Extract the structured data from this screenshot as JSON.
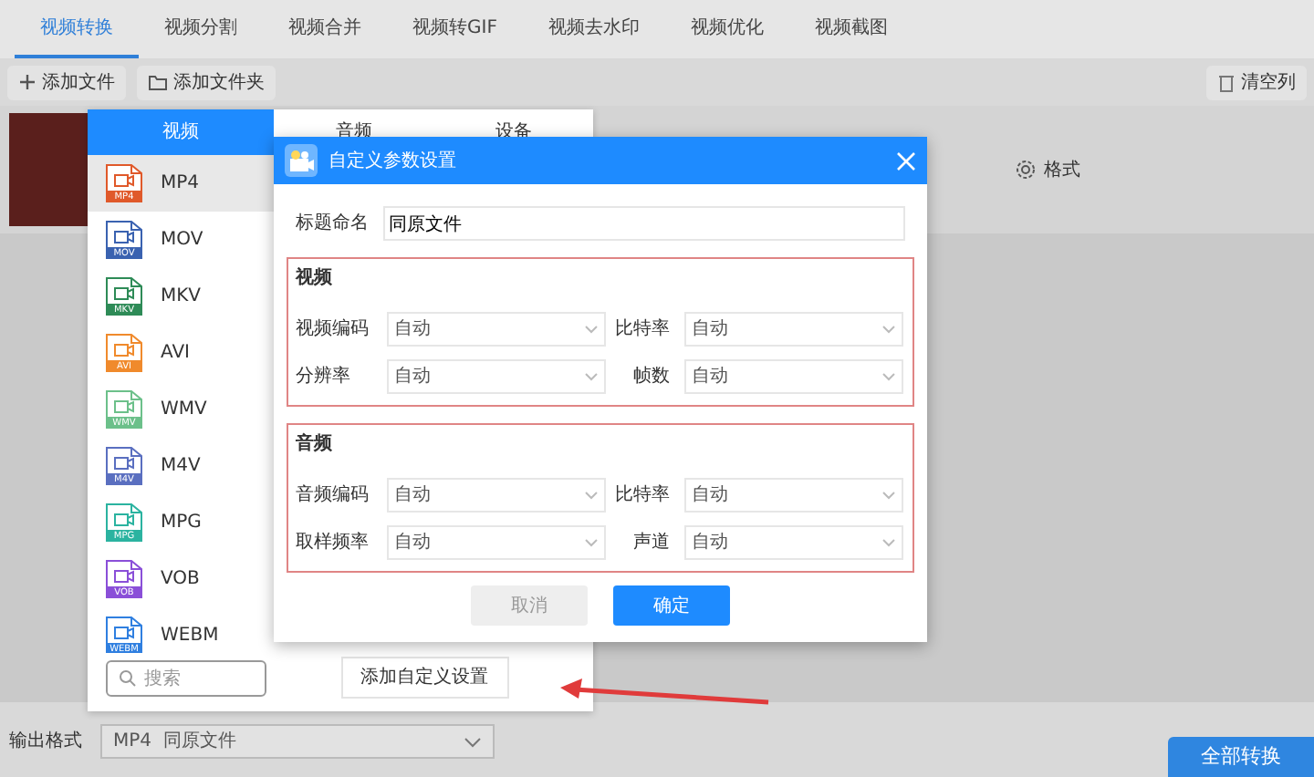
{
  "tabs": [
    {
      "label": "视频转换",
      "selected": true
    },
    {
      "label": "视频分割",
      "selected": false
    },
    {
      "label": "视频合并",
      "selected": false
    },
    {
      "label": "视频转GIF",
      "selected": false
    },
    {
      "label": "视频去水印",
      "selected": false
    },
    {
      "label": "视频优化",
      "selected": false
    },
    {
      "label": "视频截图",
      "selected": false
    }
  ],
  "toolbar": {
    "add_file": "添加文件",
    "add_folder": "添加文件夹",
    "clear_list": "清空列"
  },
  "file": {
    "format_button": "格式"
  },
  "format_panel": {
    "tabs": [
      {
        "label": "视频",
        "selected": true
      },
      {
        "label": "音频",
        "selected": false
      },
      {
        "label": "设备",
        "selected": false
      }
    ],
    "formats": [
      {
        "label": "MP4",
        "badge": "MP4",
        "color": "#e0592a",
        "selected": true
      },
      {
        "label": "MOV",
        "badge": "MOV",
        "color": "#3a62b0",
        "selected": false
      },
      {
        "label": "MKV",
        "badge": "MKV",
        "color": "#2e8b57",
        "selected": false
      },
      {
        "label": "AVI",
        "badge": "AVI",
        "color": "#f08a2c",
        "selected": false
      },
      {
        "label": "WMV",
        "badge": "WMV",
        "color": "#6cc08a",
        "selected": false
      },
      {
        "label": "M4V",
        "badge": "M4V",
        "color": "#5a6fc0",
        "selected": false
      },
      {
        "label": "MPG",
        "badge": "MPG",
        "color": "#2bb3a0",
        "selected": false
      },
      {
        "label": "VOB",
        "badge": "VOB",
        "color": "#8a4fd8",
        "selected": false
      },
      {
        "label": "WEBM",
        "badge": "WEBM",
        "color": "#2f7fe0",
        "selected": false
      }
    ],
    "search": {
      "placeholder": "搜索"
    },
    "add_custom_button": "添加自定义设置"
  },
  "dialog": {
    "title": "自定义参数设置",
    "name_field": {
      "label": "标题命名",
      "value": "同原文件"
    },
    "sections": [
      {
        "title": "视频",
        "fields": [
          {
            "label": "视频编码",
            "value": "自动"
          },
          {
            "label": "比特率",
            "value": "自动"
          },
          {
            "label": "分辨率",
            "value": "自动"
          },
          {
            "label": "帧数",
            "value": "自动"
          }
        ]
      },
      {
        "title": "音频",
        "fields": [
          {
            "label": "音频编码",
            "value": "自动"
          },
          {
            "label": "比特率",
            "value": "自动"
          },
          {
            "label": "取样频率",
            "value": "自动"
          },
          {
            "label": "声道",
            "value": "自动"
          }
        ]
      }
    ],
    "buttons": [
      {
        "label": "取消",
        "kind": "cancel"
      },
      {
        "label": "确定",
        "kind": "primary"
      }
    ]
  },
  "bottom": {
    "output_label": "输出格式",
    "output_value": "MP4  同原文件",
    "convert_all": "全部转换"
  }
}
